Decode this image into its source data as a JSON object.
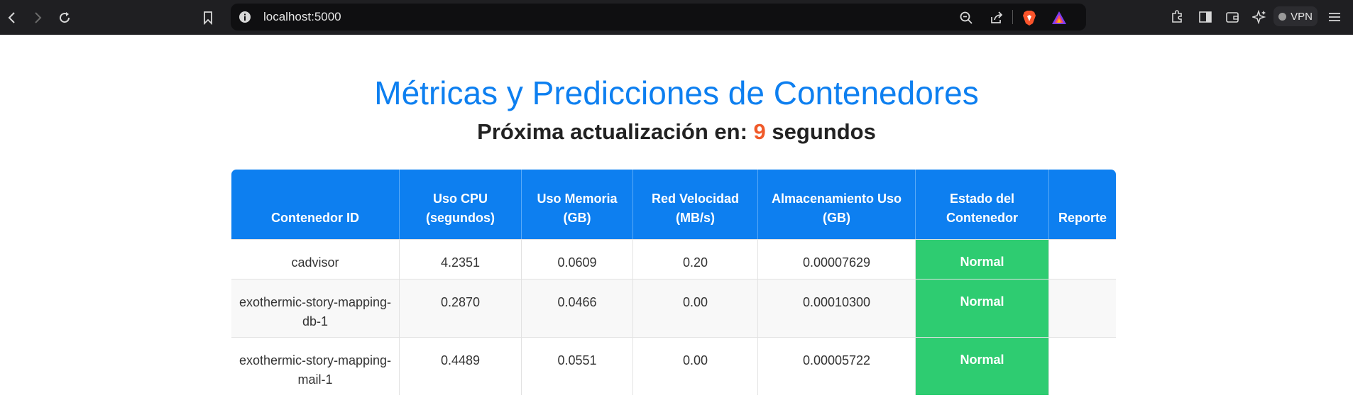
{
  "browser": {
    "url": "localhost:5000",
    "vpn_label": "VPN"
  },
  "page": {
    "title": "Métricas y Predicciones de Contenedores",
    "subtitle_prefix": "Próxima actualización en:",
    "countdown": "9",
    "subtitle_suffix": "segundos"
  },
  "table": {
    "headers": [
      "Contenedor ID",
      "Uso CPU (segundos)",
      "Uso Memoria (GB)",
      "Red Velocidad (MB/s)",
      "Almacenamiento Uso (GB)",
      "Estado del Contenedor",
      "Reporte"
    ],
    "rows": [
      {
        "id": "cadvisor",
        "cpu": "4.2351",
        "mem": "0.0609",
        "net": "0.20",
        "storage": "0.00007629",
        "status": "Normal",
        "report": ""
      },
      {
        "id": "exothermic-story-mapping-db-1",
        "cpu": "0.2870",
        "mem": "0.0466",
        "net": "0.00",
        "storage": "0.00010300",
        "status": "Normal",
        "report": ""
      },
      {
        "id": "exothermic-story-mapping-mail-1",
        "cpu": "0.4489",
        "mem": "0.0551",
        "net": "0.00",
        "storage": "0.00005722",
        "status": "Normal",
        "report": ""
      }
    ]
  },
  "colors": {
    "accent": "#0d7ff0",
    "status_normal": "#2ecc71",
    "countdown": "#f05a2a"
  }
}
